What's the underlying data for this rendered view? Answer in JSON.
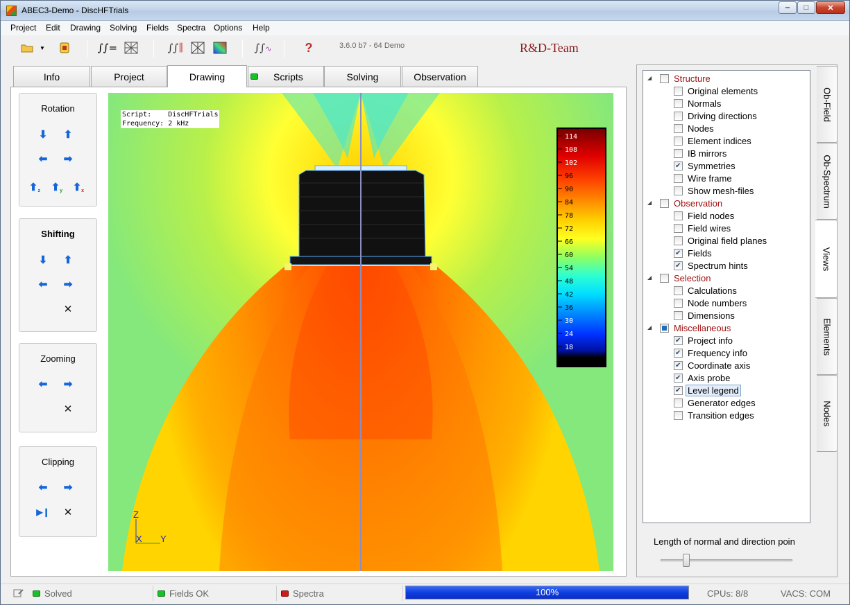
{
  "window": {
    "title": "ABEC3-Demo - DiscHFTrials",
    "minimize_icon": "minimize-icon",
    "maximize_icon": "maximize-icon",
    "close_icon": "close-icon"
  },
  "menu": [
    "Project",
    "Edit",
    "Drawing",
    "Solving",
    "Fields",
    "Spectra",
    "Options",
    "Help"
  ],
  "toolbar": {
    "version": "3.6.0 b7 - 64 Demo",
    "brand": "R&D-Team",
    "icons": [
      "open-folder-icon",
      "dropdown-arrow-icon",
      "save-icon",
      "script-icon",
      "mesh-icon",
      "field-script-icon",
      "wireframe-icon",
      "colormap-icon",
      "spectrum-icon",
      "help-icon"
    ]
  },
  "tabs": [
    {
      "label": "Info",
      "active": false
    },
    {
      "label": "Project",
      "active": false
    },
    {
      "label": "Drawing",
      "active": true
    },
    {
      "label": "Scripts",
      "active": false,
      "led": "#19c129"
    },
    {
      "label": "Solving",
      "active": false
    },
    {
      "label": "Observation",
      "active": false
    }
  ],
  "controls": {
    "rotation": {
      "title": "Rotation",
      "axes": [
        "z",
        "y",
        "x"
      ]
    },
    "shifting": {
      "title": "Shifting"
    },
    "zooming": {
      "title": "Zooming"
    },
    "clipping": {
      "title": "Clipping"
    }
  },
  "viewport": {
    "info_line1": "Script:    DiscHFTrials",
    "info_line2": "Frequency: 2 kHz",
    "legend_ticks": [
      "114",
      "108",
      "102",
      "96",
      "90",
      "84",
      "78",
      "72",
      "66",
      "60",
      "54",
      "48",
      "42",
      "36",
      "30",
      "24",
      "18"
    ],
    "axis": {
      "z": "Z",
      "x": "X",
      "y": "Y"
    }
  },
  "tree": [
    {
      "type": "group",
      "label": "Structure",
      "state": "unchecked"
    },
    {
      "type": "item",
      "label": "Original elements",
      "checked": false
    },
    {
      "type": "item",
      "label": "Normals",
      "checked": false
    },
    {
      "type": "item",
      "label": "Driving directions",
      "checked": false
    },
    {
      "type": "item",
      "label": "Nodes",
      "checked": false
    },
    {
      "type": "item",
      "label": "Element indices",
      "checked": false
    },
    {
      "type": "item",
      "label": "IB mirrors",
      "checked": false
    },
    {
      "type": "item",
      "label": "Symmetries",
      "checked": true
    },
    {
      "type": "item",
      "label": "Wire frame",
      "checked": false
    },
    {
      "type": "item",
      "label": "Show mesh-files",
      "checked": false
    },
    {
      "type": "group",
      "label": "Observation",
      "state": "unchecked"
    },
    {
      "type": "item",
      "label": "Field nodes",
      "checked": false
    },
    {
      "type": "item",
      "label": "Field wires",
      "checked": false
    },
    {
      "type": "item",
      "label": "Original field planes",
      "checked": false
    },
    {
      "type": "item",
      "label": "Fields",
      "checked": true
    },
    {
      "type": "item",
      "label": "Spectrum hints",
      "checked": true
    },
    {
      "type": "group",
      "label": "Selection",
      "state": "unchecked"
    },
    {
      "type": "item",
      "label": "Calculations",
      "checked": false
    },
    {
      "type": "item",
      "label": "Node numbers",
      "checked": false
    },
    {
      "type": "item",
      "label": "Dimensions",
      "checked": false
    },
    {
      "type": "group",
      "label": "Miscellaneous",
      "state": "partial"
    },
    {
      "type": "item",
      "label": "Project info",
      "checked": true
    },
    {
      "type": "item",
      "label": "Frequency info",
      "checked": true
    },
    {
      "type": "item",
      "label": "Coordinate axis",
      "checked": true
    },
    {
      "type": "item",
      "label": "Axis probe",
      "checked": true
    },
    {
      "type": "item",
      "label": "Level legend",
      "checked": true,
      "selected": true
    },
    {
      "type": "item",
      "label": "Generator edges",
      "checked": false
    },
    {
      "type": "item",
      "label": "Transition edges",
      "checked": false
    }
  ],
  "slider": {
    "label": "Length of normal and direction poin",
    "value": 0.2
  },
  "side_tabs": [
    {
      "label": "Ob-Field",
      "active": false
    },
    {
      "label": "Ob-Spectrum",
      "active": false
    },
    {
      "label": "Views",
      "active": true
    },
    {
      "label": "Elements",
      "active": false
    },
    {
      "label": "Nodes",
      "active": false
    }
  ],
  "status": {
    "solved": "Solved",
    "fields": "Fields OK",
    "spectra": "Spectra",
    "progress": "100%",
    "progress_value": 100,
    "cpus": "CPUs: 8/8",
    "vacs": "VACS: COM",
    "colors": {
      "ok": "#19c129",
      "error": "#d11b1b"
    }
  }
}
